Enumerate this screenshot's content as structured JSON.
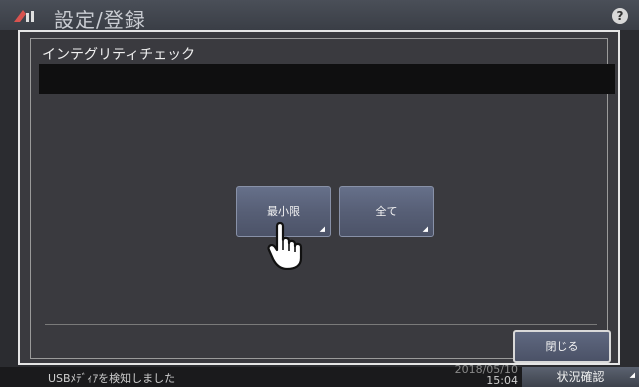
{
  "app": {
    "title": "設定/登録",
    "help_glyph": "?"
  },
  "dialog": {
    "title": "インテグリティチェック",
    "buttons": {
      "minimum": "最小限",
      "all": "全て",
      "close": "閉じる"
    }
  },
  "status_bar": {
    "message": "USBﾒﾃﾞｨｱを検知しました",
    "date": "2018/05/10",
    "time": "15:04",
    "status_button": "状況確認"
  },
  "icons": {
    "app_logo": "settings-logo-icon",
    "help": "help-icon",
    "hand": "pointing-hand-icon",
    "arrow": "corner-arrow-icon"
  },
  "colors": {
    "dialog_bg": "#3a3a3f",
    "button_bg": "#575f76",
    "border": "#e6e6e6"
  }
}
